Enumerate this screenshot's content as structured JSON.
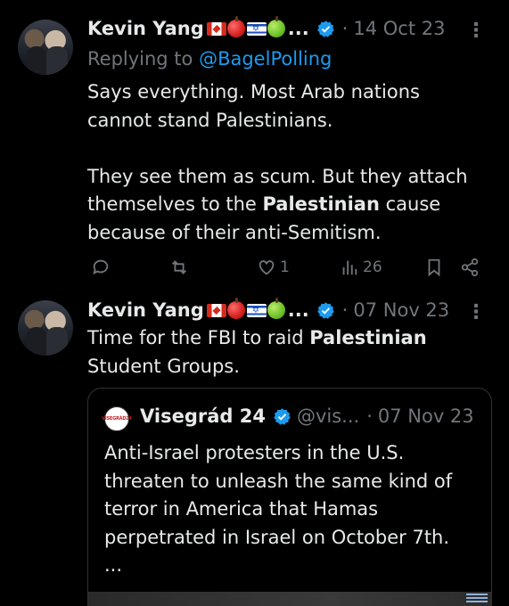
{
  "tweets": [
    {
      "author": "Kevin Yang",
      "name_suffix": "...",
      "date": "14 Oct 23",
      "replying_prefix": "Replying to ",
      "replying_handle": "@BagelPolling",
      "body_lines": [
        "Says everything. Most Arab nations",
        "cannot stand Palestinians.",
        "",
        "They see them as scum. But they attach",
        "themselves to the ",
        "Palestinian",
        " cause",
        "because of their anti-Semitism."
      ],
      "likes": "1",
      "views": "26"
    },
    {
      "author": "Kevin Yang",
      "name_suffix": "...",
      "date": "07 Nov 23",
      "body_line1_pre": "Time for the FBI to raid ",
      "body_line1_bold": "Palestinian",
      "body_line2": "Student Groups."
    }
  ],
  "quote": {
    "avatar_text": "VISEGRÁD24",
    "name": "Visegrád 24",
    "handle": "@vis...",
    "date": "07 Nov 23",
    "body_lines": [
      "Anti-Israel protesters in the U.S.",
      "threaten to unleash the same kind of",
      "terror in America that Hamas",
      "perpetrated in Israel on October 7th.",
      "..."
    ]
  },
  "icons": [
    "reply-icon",
    "retweet-icon",
    "like-icon",
    "views-icon",
    "bookmark-icon",
    "share-icon",
    "verified-icon",
    "more-icon"
  ],
  "colors": {
    "background": "#000000",
    "text": "#e7e9ea",
    "muted": "#71767b",
    "link": "#1d9bf0",
    "verified": "#1d9bf0"
  }
}
